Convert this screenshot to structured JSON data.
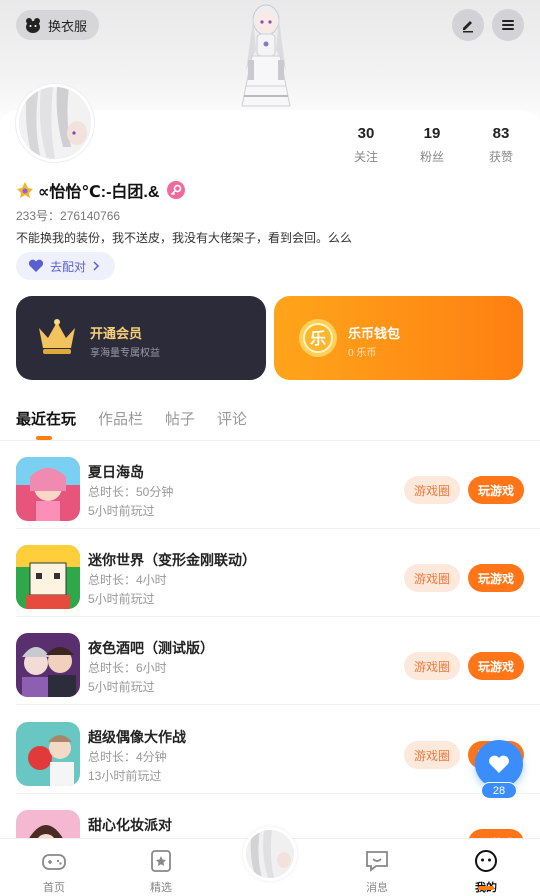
{
  "header": {
    "wardrobe_label": "换衣服",
    "icons": [
      "wardrobe-icon",
      "edit-icon",
      "menu-icon"
    ]
  },
  "profile": {
    "name": "∝怡怡℃:-白团.&",
    "uid": "233号：276140766",
    "bio": "不能换我的装份，我不送皮，我没有大佬架子，看到会回。么么",
    "pair_label": "去配对",
    "stats": [
      {
        "num": "30",
        "label": "关注"
      },
      {
        "num": "19",
        "label": "粉丝"
      },
      {
        "num": "83",
        "label": "获赞"
      }
    ]
  },
  "cards": {
    "vip": {
      "title": "开通会员",
      "subtitle": "享海量专属权益"
    },
    "wallet": {
      "title": "乐币钱包",
      "subtitle": "0 乐币",
      "coin_char": "乐"
    }
  },
  "tabs": [
    "最近在玩",
    "作品栏",
    "帖子",
    "评论"
  ],
  "buttons": {
    "circle": "游戏圈",
    "play": "玩游戏"
  },
  "games": [
    {
      "title": "夏日海岛",
      "duration": "总时长：50分钟",
      "last": "5小时前玩过"
    },
    {
      "title": "迷你世界（变形金刚联动）",
      "duration": "总时长：4小时",
      "last": "5小时前玩过"
    },
    {
      "title": "夜色酒吧（测试版）",
      "duration": "总时长：6小时",
      "last": "5小时前玩过"
    },
    {
      "title": "超级偶像大作战",
      "duration": "总时长：4分钟",
      "last": "13小时前玩过"
    },
    {
      "title": "甜心化妆派对",
      "duration": "",
      "last": ""
    }
  ],
  "fab": {
    "count": "28"
  },
  "nav": [
    {
      "label": "首页"
    },
    {
      "label": "精选"
    },
    {
      "label": "消息"
    },
    {
      "label": "我的"
    }
  ],
  "colors": {
    "accent": "#ff7518",
    "vip_bg": "#2b2b3a",
    "fab": "#3b8dfb"
  }
}
